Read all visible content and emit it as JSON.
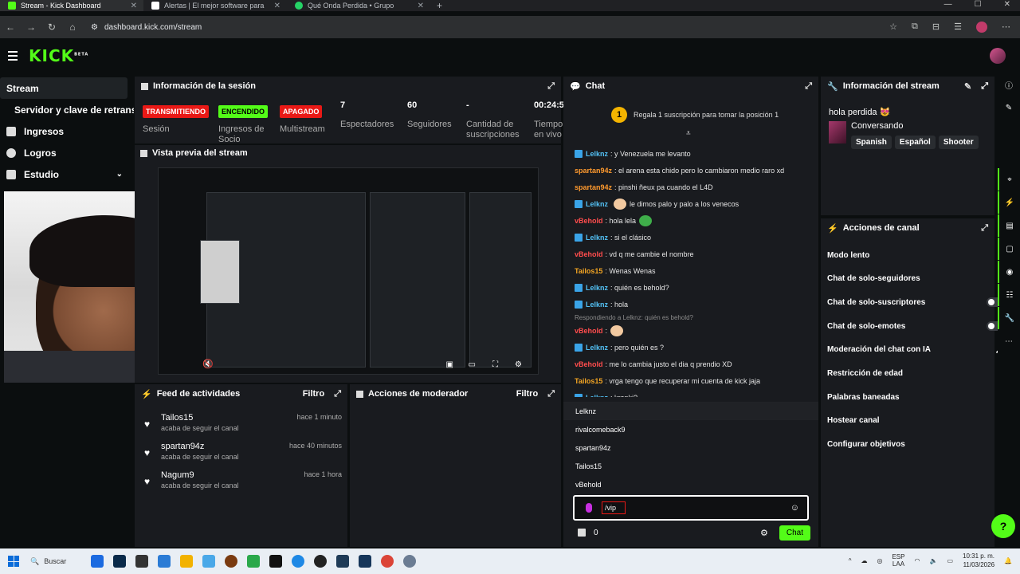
{
  "browser": {
    "tabs": [
      {
        "title": "Stream - Kick Dashboard",
        "active": true,
        "fav_color": "#53fc18"
      },
      {
        "title": "Alertas | El mejor software para",
        "active": false,
        "fav_color": "#ffffff"
      },
      {
        "title": "Qué Onda Perdida • Grupo",
        "active": false,
        "fav_color": "#25d366"
      }
    ],
    "url": "dashboard.kick.com/stream"
  },
  "logo": {
    "text": "KICK",
    "beta": "BETA"
  },
  "sidebar": {
    "items": [
      {
        "label": "Stream",
        "active": true
      },
      {
        "label": "Servidor y clave de retransmisión",
        "sub": true
      },
      {
        "label": "Ingresos"
      },
      {
        "label": "Logros"
      },
      {
        "label": "Estudio",
        "chevron": "⌄"
      }
    ]
  },
  "session": {
    "title": "Información de la sesión",
    "stats": [
      {
        "value": "TRANSMITIENDO",
        "kind": "badge-red",
        "label": "Sesión"
      },
      {
        "value": "ENCENDIDO",
        "kind": "badge-green",
        "label": "Ingresos de Socio"
      },
      {
        "value": "APAGADO",
        "kind": "badge-red",
        "label": "Multistream"
      },
      {
        "value": "7",
        "label": "Espectadores"
      },
      {
        "value": "60",
        "label": "Seguidores"
      },
      {
        "value": "-",
        "label": "Cantidad de suscripciones"
      },
      {
        "value": "00:24:5",
        "label": "Tiempo en vivo"
      }
    ]
  },
  "preview": {
    "title": "Vista previa del stream"
  },
  "feed": {
    "title": "Feed de actividades",
    "filter": "Filtro",
    "items": [
      {
        "name": "Tailos15",
        "action": "acaba de seguir el canal",
        "time": "hace 1 minuto"
      },
      {
        "name": "spartan94z",
        "action": "acaba de seguir el canal",
        "time": "hace 40 minutos"
      },
      {
        "name": "Nagum9",
        "action": "acaba de seguir el canal",
        "time": "hace 1 hora"
      }
    ]
  },
  "modactions": {
    "title": "Acciones de moderador",
    "filter": "Filtro"
  },
  "chat": {
    "title": "Chat",
    "banner": "Regala 1 suscripción para tomar la posición 1",
    "banner_num": "1",
    "messages": [
      {
        "user": "Lelknz",
        "color": "#53c1f5",
        "badge": true,
        "text": ": y Venezuela me levanto"
      },
      {
        "user": "spartan94z",
        "color": "#ff9a2e",
        "text": ": el arena esta chido pero lo cambiaron medio raro xd"
      },
      {
        "user": "spartan94z",
        "color": "#ff9a2e",
        "text": ": pinshi ñeux pa cuando el L4D"
      },
      {
        "user": "Lelknz",
        "color": "#53c1f5",
        "badge": true,
        "emote": "#f2c9a0",
        "text": " le dimos palo y palo a los venecos"
      },
      {
        "user": "vBehold",
        "color": "#ff4d4d",
        "text": ": hola lela",
        "emote_after": "#3fae4a"
      },
      {
        "user": "Lelknz",
        "color": "#53c1f5",
        "badge": true,
        "text": ": si el clásico"
      },
      {
        "user": "vBehold",
        "color": "#ff4d4d",
        "text": ": vd q me cambie el nombre"
      },
      {
        "user": "Tailos15",
        "color": "#f5a623",
        "text": ": Wenas Wenas"
      },
      {
        "user": "Lelknz",
        "color": "#53c1f5",
        "badge": true,
        "text": ": quién es behold?"
      },
      {
        "user": "Lelknz",
        "color": "#53c1f5",
        "badge": true,
        "text": ": hola"
      },
      {
        "reply": "Respondiendo a Lelknz: quién es behold?"
      },
      {
        "user": "vBehold",
        "color": "#ff4d4d",
        "text": ":",
        "emote_after": "#f2c9a0"
      },
      {
        "user": "Lelknz",
        "color": "#53c1f5",
        "badge": true,
        "text": ": pero quién es ?"
      },
      {
        "user": "vBehold",
        "color": "#ff4d4d",
        "text": ": me lo cambia justo el dia q prendio XD"
      },
      {
        "user": "Tailos15",
        "color": "#f5a623",
        "text": ": vrga tengo que recuperar mi cuenta de kick jaja"
      },
      {
        "user": "Lelknz",
        "color": "#53c1f5",
        "badge": true,
        "text": ": kranki?"
      }
    ],
    "mentions": [
      "Lelknz",
      "rivalcomeback9",
      "spartan94z",
      "Tailos15",
      "vBehold"
    ],
    "input_value": "/vip",
    "points": "0",
    "send_label": "Chat"
  },
  "stream_info": {
    "title": "Información del stream",
    "stream_title": "hola perdida 😻",
    "category": "Conversando",
    "tags": [
      "Spanish",
      "Español",
      "Shooter"
    ]
  },
  "channel_actions": {
    "title": "Acciones de canal",
    "items": [
      {
        "label": "Modo lento",
        "control": "›"
      },
      {
        "label": "Chat de solo-seguidores",
        "control": "›"
      },
      {
        "label": "Chat de solo-suscriptores",
        "control": "toggle"
      },
      {
        "label": "Chat de solo-emotes",
        "control": "toggle"
      },
      {
        "label": "Moderación del chat con IA",
        "control": "↗"
      },
      {
        "label": "Restricción de edad",
        "control": "›"
      },
      {
        "label": "Palabras baneadas",
        "control": "›"
      },
      {
        "label": "Hostear canal",
        "control": ""
      },
      {
        "label": "Configurar objetivos",
        "control": "›"
      }
    ]
  },
  "taskbar": {
    "search": "Buscar",
    "lang": "ESP",
    "lang2": "LAA",
    "time": "10:31 p. m.",
    "date": "11/03/2026"
  }
}
